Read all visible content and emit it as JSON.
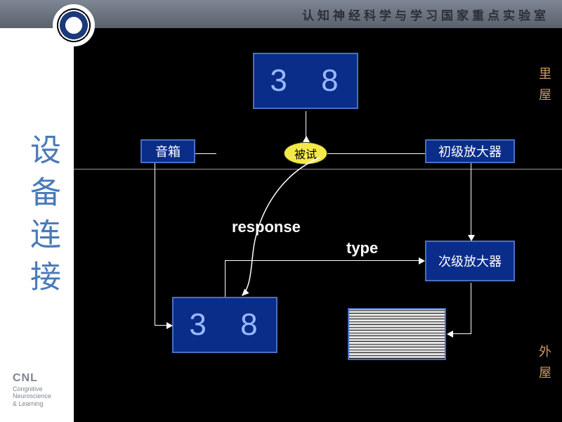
{
  "header": {
    "title": "认知神经科学与学习国家重点实验室"
  },
  "side_title": "设备连接",
  "footer": {
    "line1": "CNL",
    "line2": "Congnitive Neuroscience",
    "line3": "& Learning"
  },
  "room_labels": {
    "inner": "里屋",
    "outer": "外屋"
  },
  "nodes": {
    "display_top": "3 8",
    "speaker": "音箱",
    "subject": "被试",
    "pre_amp": "初级放大器",
    "sec_amp": "次级放大器",
    "display_bottom": "3 8"
  },
  "edge_labels": {
    "response": "response",
    "type": "type"
  }
}
